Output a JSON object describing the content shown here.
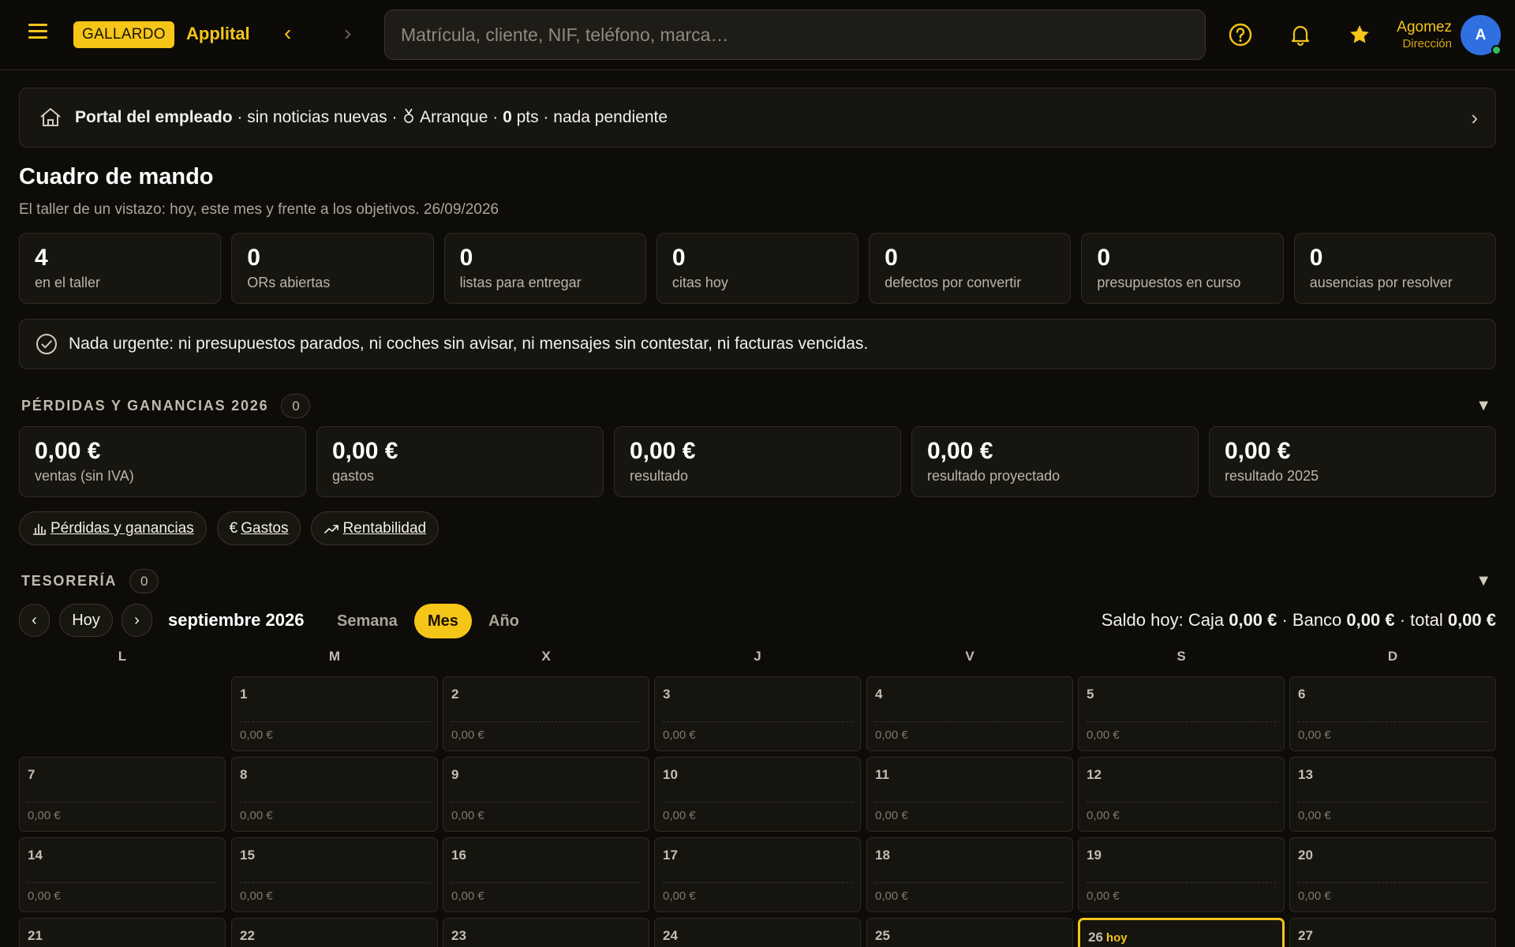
{
  "colors": {
    "accent": "#f5c518",
    "avatar": "#2f6fe0",
    "online": "#2fbf5a"
  },
  "topbar": {
    "brand_badge": "GALLARDO",
    "brand_name": "Applital",
    "search_placeholder": "Matrícula, cliente, NIF, teléfono, marca…",
    "user_name": "Agomez",
    "user_role": "Dirección",
    "avatar_initial": "A",
    "icons": [
      "menu-icon",
      "back-icon",
      "forward-icon",
      "help-icon",
      "bell-icon",
      "star-icon"
    ]
  },
  "portal": {
    "title": "Portal del empleado",
    "news": " · sin noticias nuevas · ",
    "level": " Arranque · ",
    "points": "0",
    "tail": " pts · nada pendiente"
  },
  "header": {
    "title": "Cuadro de mando",
    "subtitle": "El taller de un vistazo: hoy, este mes y frente a los objetivos. 26/09/2026"
  },
  "kpis": [
    {
      "value": "4",
      "label": "en el taller"
    },
    {
      "value": "0",
      "label": "ORs abiertas"
    },
    {
      "value": "0",
      "label": "listas para entregar"
    },
    {
      "value": "0",
      "label": "citas hoy"
    },
    {
      "value": "0",
      "label": "defectos por convertir"
    },
    {
      "value": "0",
      "label": "presupuestos en curso"
    },
    {
      "value": "0",
      "label": "ausencias por resolver"
    }
  ],
  "urgent": {
    "text": "Nada urgente: ni presupuestos parados, ni coches sin avisar, ni mensajes sin contestar, ni facturas vencidas."
  },
  "pl": {
    "title": "PÉRDIDAS Y GANANCIAS 2026",
    "count": "0",
    "cards": [
      {
        "value": "0,00 €",
        "label": "ventas (sin IVA)"
      },
      {
        "value": "0,00 €",
        "label": "gastos"
      },
      {
        "value": "0,00 €",
        "label": "resultado"
      },
      {
        "value": "0,00 €",
        "label": "resultado proyectado"
      },
      {
        "value": "0,00 €",
        "label": "resultado 2025"
      }
    ],
    "links": [
      {
        "label": "Pérdidas y ganancias",
        "icon": "bar-chart-icon"
      },
      {
        "label": "Gastos",
        "icon": "euro-icon"
      },
      {
        "label": "Rentabilidad",
        "icon": "trend-up-icon"
      }
    ]
  },
  "tesoreria": {
    "title": "TESORERÍA",
    "count": "0",
    "prev": "‹",
    "next": "›",
    "today_label": "Hoy",
    "period": "septiembre 2026",
    "views": [
      "Semana",
      "Mes",
      "Año"
    ],
    "active_view": "Mes",
    "saldo": {
      "prefix": "Saldo hoy: Caja ",
      "caja": "0,00 €",
      "banco_label": " · Banco ",
      "banco": "0,00 €",
      "total_label": " · total ",
      "total": "0,00 €"
    },
    "weekdays": [
      "L",
      "M",
      "X",
      "J",
      "V",
      "S",
      "D"
    ],
    "today_tag": "hoy",
    "today_day": 26,
    "first_weekday_offset": 1,
    "days": [
      {
        "d": "1",
        "amount": "0,00 €"
      },
      {
        "d": "2",
        "amount": "0,00 €"
      },
      {
        "d": "3",
        "amount": "0,00 €"
      },
      {
        "d": "4",
        "amount": "0,00 €"
      },
      {
        "d": "5",
        "amount": "0,00 €"
      },
      {
        "d": "6",
        "amount": "0,00 €"
      },
      {
        "d": "7",
        "amount": "0,00 €"
      },
      {
        "d": "8",
        "amount": "0,00 €"
      },
      {
        "d": "9",
        "amount": "0,00 €"
      },
      {
        "d": "10",
        "amount": "0,00 €"
      },
      {
        "d": "11",
        "amount": "0,00 €"
      },
      {
        "d": "12",
        "amount": "0,00 €"
      },
      {
        "d": "13",
        "amount": "0,00 €"
      },
      {
        "d": "14",
        "amount": "0,00 €"
      },
      {
        "d": "15",
        "amount": "0,00 €"
      },
      {
        "d": "16",
        "amount": "0,00 €"
      },
      {
        "d": "17",
        "amount": "0,00 €"
      },
      {
        "d": "18",
        "amount": "0,00 €"
      },
      {
        "d": "19",
        "amount": "0,00 €"
      },
      {
        "d": "20",
        "amount": "0,00 €"
      },
      {
        "d": "21",
        "amount": ""
      },
      {
        "d": "22",
        "amount": ""
      },
      {
        "d": "23",
        "amount": ""
      },
      {
        "d": "24",
        "amount": ""
      },
      {
        "d": "25",
        "amount": ""
      },
      {
        "d": "26",
        "amount": ""
      },
      {
        "d": "27",
        "amount": ""
      }
    ]
  }
}
